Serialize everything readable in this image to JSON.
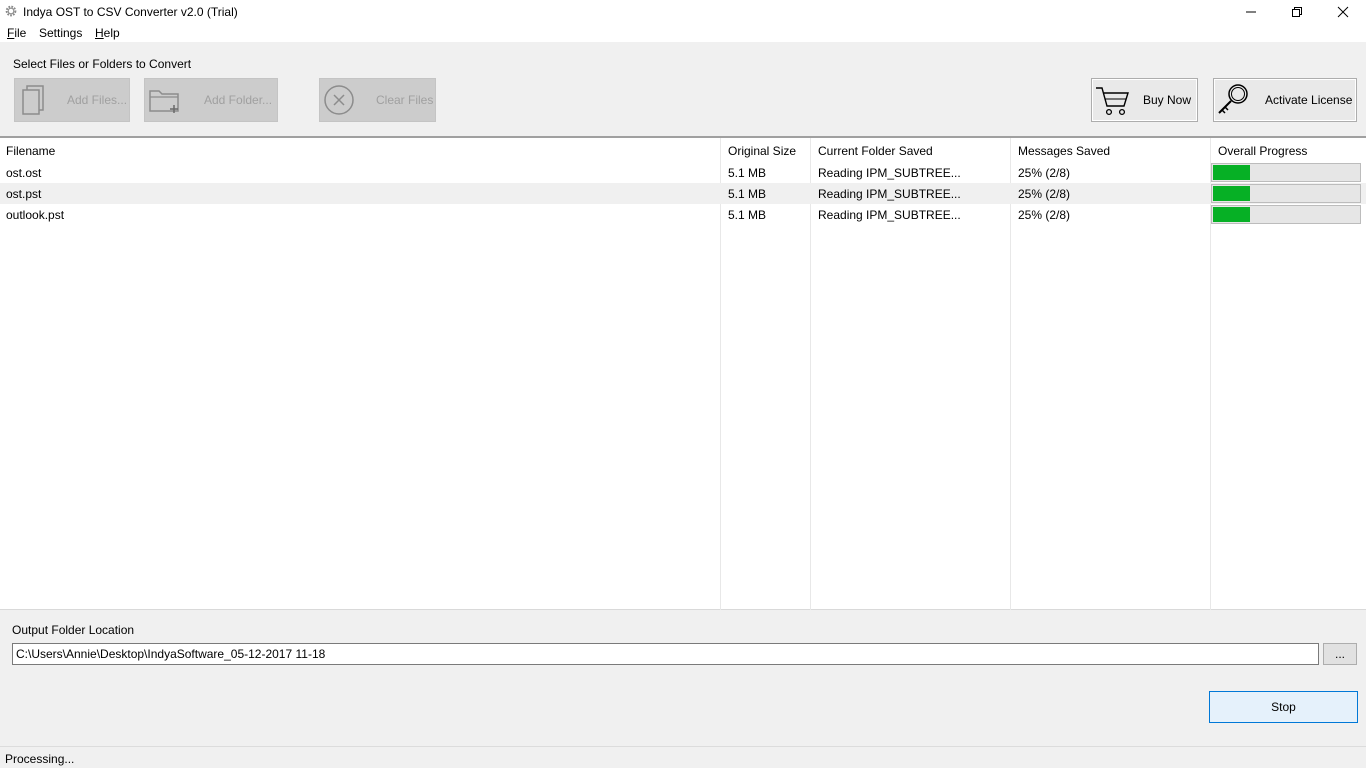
{
  "window": {
    "title": "Indya OST to CSV Converter v2.0 (Trial)",
    "icons": {
      "app": "gear-icon",
      "minimize": "minimize-icon",
      "maximize": "restore-icon",
      "close": "close-icon"
    }
  },
  "menu": {
    "items": [
      {
        "mnemonic": "F",
        "rest": "ile"
      },
      {
        "mnemonic": "",
        "rest": "Settings"
      },
      {
        "mnemonic": "H",
        "rest": "elp"
      }
    ]
  },
  "toolbar": {
    "section_label": "Select Files or Folders to Convert",
    "add_files": {
      "label": "Add Files...",
      "icon": "files-icon",
      "disabled": true
    },
    "add_folder": {
      "label": "Add Folder...",
      "icon": "folder-add-icon",
      "disabled": true
    },
    "clear_files": {
      "label": "Clear Files",
      "icon": "clear-circle-icon",
      "disabled": true
    },
    "buy_now": {
      "label": "Buy Now",
      "icon": "cart-icon"
    },
    "activate_license": {
      "label": "Activate License",
      "icon": "key-icon"
    }
  },
  "table": {
    "columns": [
      "Filename",
      "Original Size",
      "Current Folder Saved",
      "Messages Saved",
      "Overall Progress"
    ],
    "rows": [
      {
        "filename": "ost.ost",
        "size": "5.1 MB",
        "folder": "Reading IPM_SUBTREE...",
        "messages": "25% (2/8)",
        "progress": 0.25
      },
      {
        "filename": "ost.pst",
        "size": "5.1 MB",
        "folder": "Reading IPM_SUBTREE...",
        "messages": "25% (2/8)",
        "progress": 0.25
      },
      {
        "filename": "outlook.pst",
        "size": "5.1 MB",
        "folder": "Reading IPM_SUBTREE...",
        "messages": "25% (2/8)",
        "progress": 0.25
      }
    ]
  },
  "colors": {
    "progress_fill": "#06b025",
    "accent": "#0078d7"
  },
  "output": {
    "label": "Output Folder Location",
    "path": "C:\\Users\\Annie\\Desktop\\IndyaSoftware_05-12-2017 11-18",
    "browse_label": "..."
  },
  "actions": {
    "stop_label": "Stop"
  },
  "status": {
    "text": "Processing..."
  }
}
